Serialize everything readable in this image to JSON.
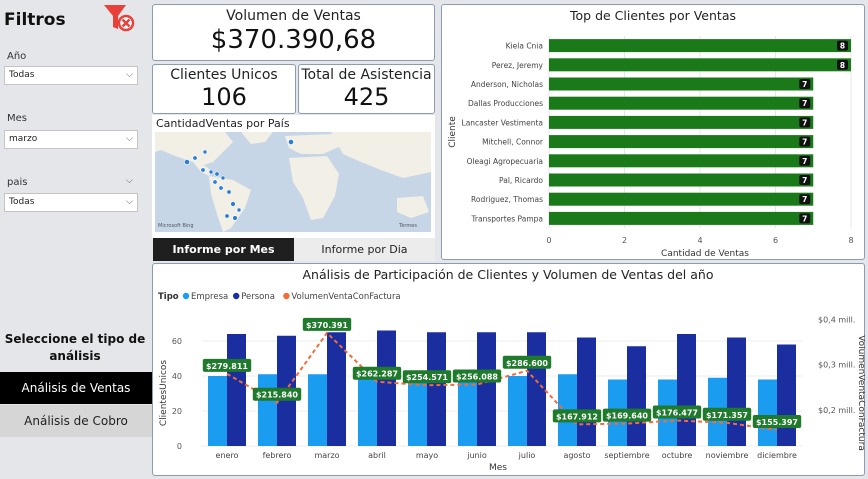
{
  "filters": {
    "title": "Filtros",
    "clear_icon": "clear-filter-icon",
    "year_label": "Año",
    "year_value": "Todas",
    "month_label": "Mes",
    "month_value": "marzo",
    "country_label": "pais",
    "country_value": "Todas"
  },
  "analysis": {
    "title_line1": "Seleccione el tipo de",
    "title_line2": "análisis",
    "ventas_label": "Análisis de Ventas",
    "cobro_label": "Análisis de Cobro"
  },
  "cards": {
    "sales_title": "Volumen de Ventas",
    "sales_value": "$370.390,68",
    "clients_title": "Clientes Unicos",
    "clients_value": "106",
    "attendance_title": "Total de Asistencia",
    "attendance_value": "425"
  },
  "map": {
    "title": "CantidadVentas por País",
    "attribution_left": "Microsoft Bing",
    "attribution_right": "Tèrmes"
  },
  "report_tabs": {
    "mes_label": "Informe por Mes",
    "dia_label": "Informe por Dia"
  },
  "colors": {
    "bar_green": "#1a7a1a",
    "empresa": "#1a9cf0",
    "persona": "#1a2ea0",
    "line": "#f26b3a",
    "label_bg": "#1f7a2c"
  },
  "chart_data": [
    {
      "type": "bar",
      "orientation": "horizontal",
      "title": "Top de Clientes por Ventas",
      "xlabel": "Cantidad de Ventas",
      "ylabel": "Cliente",
      "categories": [
        "Kiela Cnia",
        "Perez, Jeremy",
        "Anderson, Nicholas",
        "Dallas Producciones",
        "Lancaster Vestimenta",
        "Mitchell, Connor",
        "Oleagi Agropecuaria",
        "Pal, Ricardo",
        "Rodriguez, Thomas",
        "Transportes Pampa"
      ],
      "values": [
        8,
        8,
        7,
        7,
        7,
        7,
        7,
        7,
        7,
        7
      ],
      "xlim": [
        0,
        8
      ],
      "xticks": [
        0,
        2,
        4,
        6,
        8
      ],
      "data_labels": [
        "8",
        "8",
        "7",
        "7",
        "7",
        "7",
        "7",
        "7",
        "7",
        "7"
      ]
    },
    {
      "type": "bar+line",
      "title": "Análisis de Participación de Clientes y Volumen de Ventas del año",
      "legend_title": "Tipo",
      "xlabel": "Mes",
      "ylabel": "ClientesUnicos",
      "y2label": "VolumenVentaConFactura",
      "categories": [
        "enero",
        "febrero",
        "marzo",
        "abril",
        "mayo",
        "junio",
        "julio",
        "agosto",
        "septiembre",
        "octubre",
        "noviembre",
        "diciembre"
      ],
      "series": [
        {
          "name": "Empresa",
          "kind": "bar",
          "values": [
            40,
            41,
            41,
            40,
            39,
            39,
            40,
            41,
            38,
            38,
            39,
            38
          ]
        },
        {
          "name": "Persona",
          "kind": "bar",
          "values": [
            64,
            63,
            65,
            66,
            65,
            65,
            65,
            62,
            57,
            64,
            62,
            58
          ]
        },
        {
          "name": "VolumenVentaConFactura",
          "kind": "line",
          "axis": "right",
          "values": [
            279811,
            215840,
            370391,
            262287,
            254571,
            256088,
            286600,
            167912,
            169640,
            176477,
            171357,
            155397
          ]
        }
      ],
      "data_labels": [
        "$279.811",
        "$215.840",
        "$370.391",
        "$262.287",
        "$254.571",
        "$256.088",
        "$286.600",
        "$167.912",
        "$169.640",
        "$176.477",
        "$171.357",
        "$155.397"
      ],
      "ylim": [
        0,
        80
      ],
      "yticks": [
        0,
        20,
        40,
        60
      ],
      "y2lim": [
        120000,
        430000
      ],
      "y2ticks": [
        200000,
        300000,
        400000
      ],
      "y2ticklabels": [
        "$0,2 mill.",
        "$0,3 mill.",
        "$0,4 mill."
      ]
    }
  ]
}
